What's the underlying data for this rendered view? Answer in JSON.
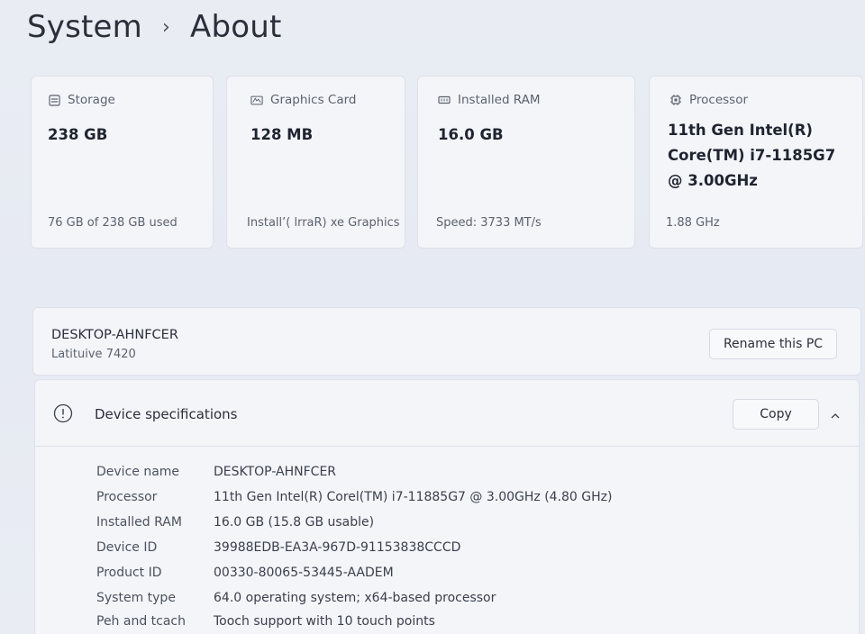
{
  "header": {
    "section": "System",
    "page": "About"
  },
  "cards": [
    {
      "icon": "storage-icon",
      "label": "Storage",
      "value": "238 GB",
      "sub": "76 GB of 238 GB used"
    },
    {
      "icon": "graphics-card-icon",
      "label": "Graphics Card",
      "value": "128 MB",
      "sub": "Install’( lrraR) xe Graphics"
    },
    {
      "icon": "ram-icon",
      "label": "Installed RAM",
      "value": "16.0 GB",
      "sub": "Speed: 3733 MT/s"
    },
    {
      "icon": "processor-icon",
      "label": "Processor",
      "value": "11th Gen Intel(R) Core(TM) i7-1185G7 @ 3.00GHz",
      "sub": "1.88 GHz"
    }
  ],
  "pc": {
    "name": "DESKTOP-AHNFCER",
    "model": "Latituive 7420",
    "rename_label": "Rename this PC"
  },
  "spec": {
    "title": "Device specifications",
    "copy_label": "Copy",
    "rows": [
      {
        "label": "Device name",
        "value": "DESKTOP-AHNFCER"
      },
      {
        "label": "Processor",
        "value": "11th Gen Intel(R) Corel(TM) i7-11885G7 @ 3.00GHz (4.80 GHz)"
      },
      {
        "label": "Installed RAM",
        "value": "16.0 GB (15.8 GB usable)"
      },
      {
        "label": "Device ID",
        "value": "39988EDB-EA3A-967D-91153838CCCD"
      },
      {
        "label": "Product ID",
        "value": "00330-80065-53445-AADEM"
      },
      {
        "label": "System type",
        "value": "64.0 operating system; x64-based processor"
      },
      {
        "label": "Peh and tcach",
        "value": "Tooch support with 10 touch points"
      }
    ]
  }
}
